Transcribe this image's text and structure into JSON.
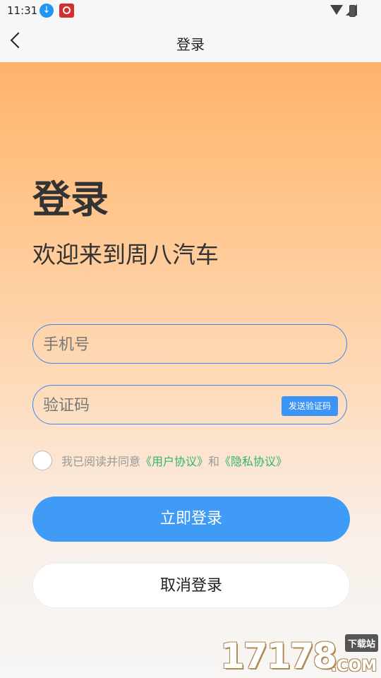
{
  "status_bar": {
    "time": "11:31"
  },
  "header": {
    "title": "登录"
  },
  "main": {
    "heading": "登录",
    "welcome": "欢迎来到周八汽车",
    "phone_placeholder": "手机号",
    "code_placeholder": "验证码",
    "send_code_label": "发送验证码",
    "agreement": {
      "prefix": "我已阅读并同意",
      "user_agreement": "《用户协议》",
      "conjunction": "和",
      "privacy_agreement": "《隐私协议》"
    },
    "login_button": "立即登录",
    "cancel_button": "取消登录"
  },
  "watermark": {
    "digits": "17178",
    "suffix": ".COM",
    "badge": "下载站"
  },
  "colors": {
    "primary_blue": "#3f9bf6",
    "input_border": "#3f88ee",
    "link_green": "#33b46c",
    "gradient_top": "#ffb36b"
  }
}
